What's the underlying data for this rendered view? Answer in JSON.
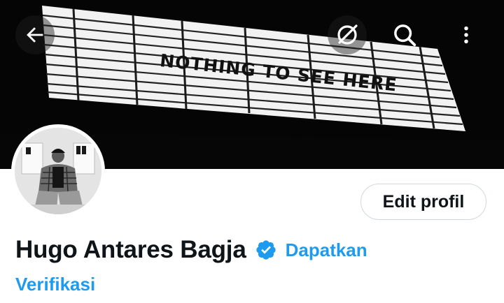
{
  "banner": {
    "sign_text": "NOTHING TO SEE HERE"
  },
  "header": {
    "back_icon": "arrow-left-icon",
    "grok_icon": "grok-icon",
    "search_icon": "search-icon",
    "more_icon": "more-vertical-icon"
  },
  "profile": {
    "display_name": "Hugo Antares Bagja",
    "verified_icon": "verified-badge-icon",
    "get_verified_line1": "Dapatkan",
    "get_verified_line2": "Verifikasi",
    "edit_button_label": "Edit profil"
  },
  "colors": {
    "accent": "#1d9bf0",
    "text_primary": "#0f1419",
    "button_border": "#cfd9de",
    "banner_bg": "#050505"
  }
}
